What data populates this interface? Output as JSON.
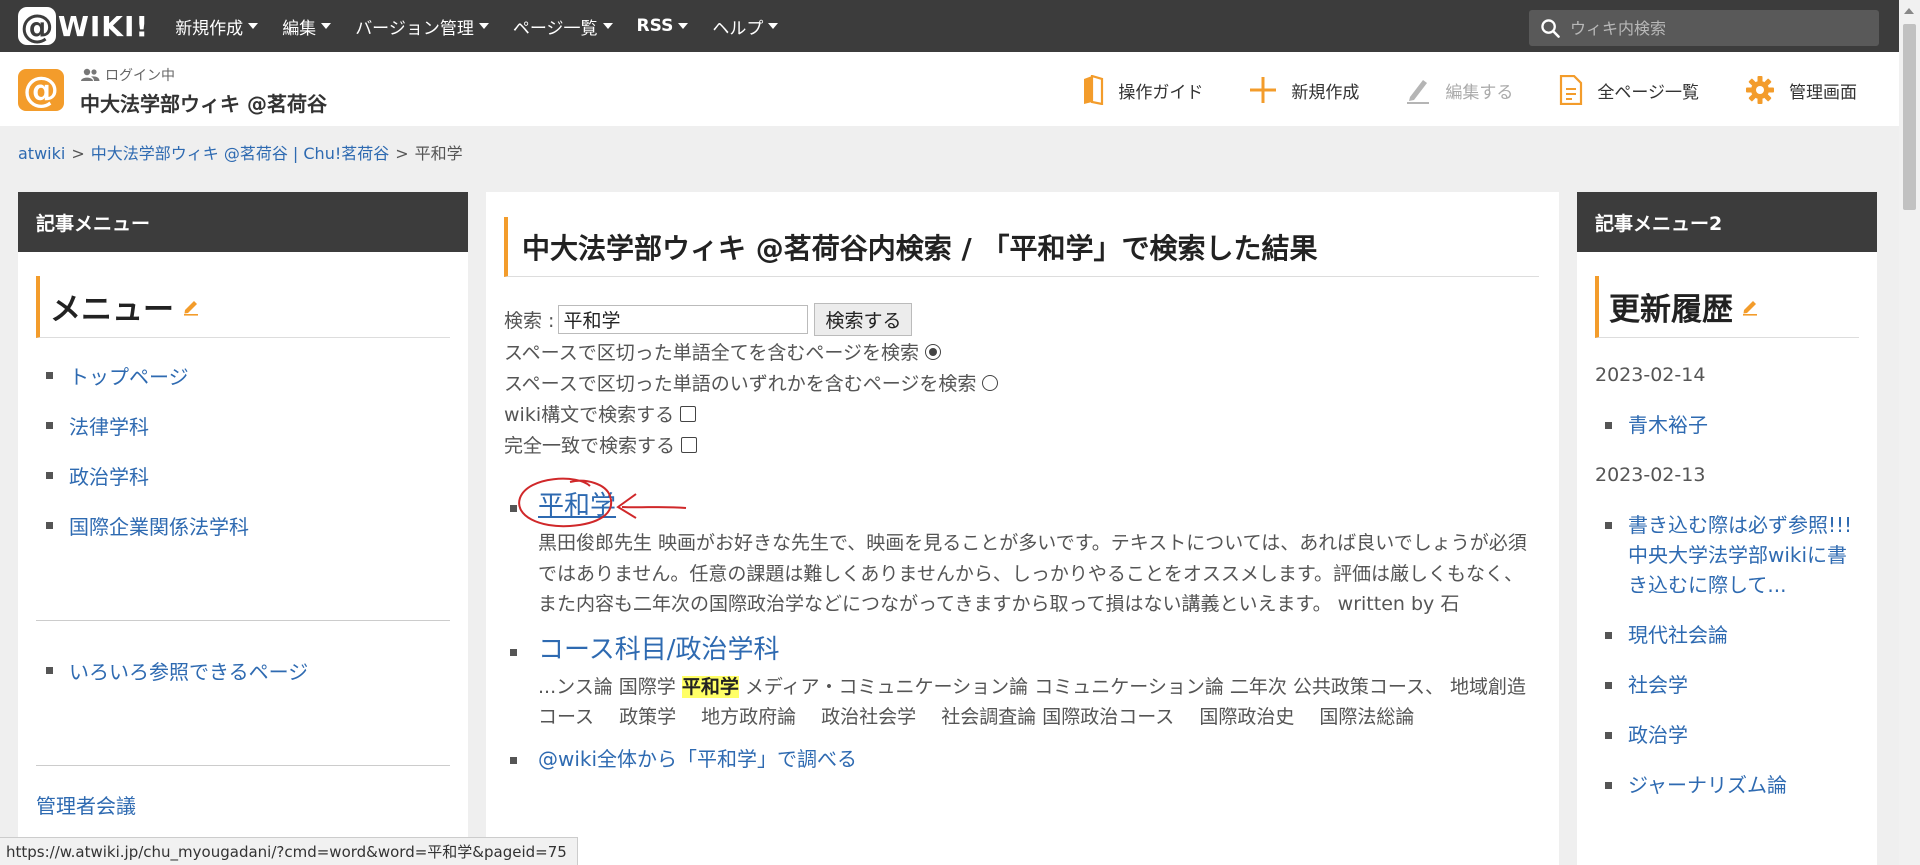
{
  "nav": {
    "logo_text": "WIKI!",
    "items": [
      {
        "label": "新規作成",
        "bold": false
      },
      {
        "label": "編集",
        "bold": false
      },
      {
        "label": "バージョン管理",
        "bold": false
      },
      {
        "label": "ページ一覧",
        "bold": false
      },
      {
        "label": "RSS",
        "bold": true
      },
      {
        "label": "ヘルプ",
        "bold": false
      }
    ],
    "search_placeholder": "ウィキ内検索"
  },
  "subbar": {
    "login_status": "ログイン中",
    "site_title": "中大法学部ウィキ @茗荷谷",
    "tools": {
      "guide": "操作ガイド",
      "new": "新規作成",
      "edit": "編集する",
      "all_pages": "全ページ一覧",
      "admin": "管理画面"
    }
  },
  "breadcrumb": {
    "root": "atwiki",
    "site": "中大法学部ウィキ @茗荷谷 | Chu!茗荷谷",
    "current": "平和学",
    "sep": ">"
  },
  "left": {
    "header": "記事メニュー",
    "title": "メニュー",
    "items": [
      "トップページ",
      "法律学科",
      "政治学科",
      "国際企業関係法学科"
    ],
    "extra_item": "いろいろ参照できるページ",
    "admin_link": "管理者会議"
  },
  "main": {
    "title": "中大法学部ウィキ @茗荷谷内検索 / 「平和学」で検索した結果",
    "search_label": "検索 :",
    "search_value": "平和学",
    "search_button": "検索する",
    "option_all": "スペースで区切った単語全てを含むページを検索",
    "option_any": "スペースで区切った単語のいずれかを含むページを検索",
    "option_wiki": "wiki構文で検索する",
    "option_exact": "完全一致で検索する",
    "results": [
      {
        "title": "平和学",
        "snippet": "黒田俊郎先生 映画がお好きな先生で、映画を見ることが多いです。テキストについては、あれば良いでしょうが必須ではありません。任意の課題は難しくありませんから、しっかりやることをオススメします。評価は厳しくもなく、また内容も二年次の国際政治学などにつながってきますから取って損はない講義といえます。 written by 石"
      },
      {
        "title": "コース科目/政治学科",
        "snippet_pre": "...ンス論 国際学 ",
        "snippet_hl": "平和学",
        "snippet_post": " メディア・コミュニケーション論 コミュニケーション論 二年次 公共政策コース、 地域創造コース　 政策学　 地方政府論　 政治社会学　 社会調査論 国際政治コース　 国際政治史　 国際法総論"
      },
      {
        "title": "@wiki全体から「平和学」で調べる"
      }
    ]
  },
  "right": {
    "header": "記事メニュー2",
    "title": "更新履歴",
    "date1": "2023-02-14",
    "group1": [
      "青木裕子"
    ],
    "date2": "2023-02-13",
    "group2": [
      "書き込む際は必ず参照!!! 中央大学法学部wikiに書き込むに際して...",
      "現代社会論",
      "社会学",
      "政治学",
      "ジャーナリズム論"
    ]
  },
  "status_url": "https://w.atwiki.jp/chu_myougadani/?cmd=word&word=平和学&pageid=75",
  "colors": {
    "accent": "#f39c2b",
    "nav_bg": "#3c3c3c",
    "link": "#2e6ab1",
    "highlight": "#ffff66",
    "annotation": "#d0282a"
  }
}
